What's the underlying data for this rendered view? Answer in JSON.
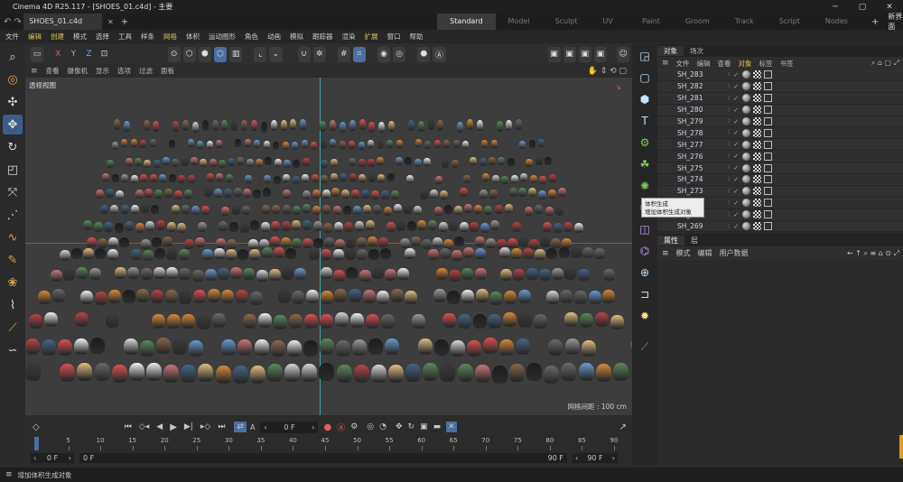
{
  "window": {
    "title": "Cinema 4D R25.117 - [SHOES_01.c4d] - 主要",
    "controls": [
      "─",
      "▢",
      "✕"
    ]
  },
  "tabs": {
    "file_tab": "SHOES_01.c4d",
    "layouts": [
      "Standard",
      "Model",
      "Sculpt",
      "UV Edit",
      "Paint",
      "Groom",
      "Track",
      "Script",
      "Nodes"
    ],
    "active_layout": "Standard",
    "new_layout": "新界面"
  },
  "menubar": [
    "文件",
    "编辑",
    "创建",
    "模式",
    "选择",
    "工具",
    "样条",
    "网格",
    "体积",
    "运动图形",
    "角色",
    "动画",
    "模拟",
    "跟踪器",
    "渲染",
    "扩展",
    "窗口",
    "帮助"
  ],
  "toolbar": {
    "axis_labels": [
      "X",
      "Y",
      "Z"
    ]
  },
  "viewport": {
    "menu": [
      "查看",
      "摄像机",
      "显示",
      "选项",
      "过滤",
      "面板"
    ],
    "label": "透视视图",
    "grid_spacing": "网格间距 : 100 cm"
  },
  "object_manager": {
    "tabs": [
      "对象",
      "场次"
    ],
    "menu": [
      "文件",
      "编辑",
      "查看",
      "对象",
      "标签",
      "书签"
    ],
    "objects": [
      "SH_283",
      "SH_282",
      "SH_281",
      "SH_280",
      "SH_279",
      "SH_278",
      "SH_277",
      "SH_276",
      "SH_275",
      "SH_274",
      "SH_273",
      "SH_272",
      "SH_271",
      "SH_269"
    ]
  },
  "tooltip": {
    "title": "体积生成",
    "desc": "增加体积生成对象"
  },
  "attributes": {
    "tabs": [
      "属性",
      "层"
    ],
    "menu": [
      "模式",
      "编辑",
      "用户数据"
    ]
  },
  "timeline": {
    "current_frame": "0 F",
    "ruler": [
      "0",
      "5",
      "10",
      "15",
      "20",
      "25",
      "30",
      "35",
      "40",
      "45",
      "50",
      "55",
      "60",
      "65",
      "70",
      "75",
      "80",
      "85",
      "90"
    ],
    "start": "0 F",
    "min": "0 F",
    "max": "90 F",
    "end": "90 F"
  },
  "status": "增加体积生成对象",
  "colors": {
    "accent": "#4a6fa0",
    "highlight": "#e2c04a",
    "x_axis": "#e85d5d",
    "y_axis": "#7ccf5a",
    "z_axis": "#6aa8ff"
  }
}
